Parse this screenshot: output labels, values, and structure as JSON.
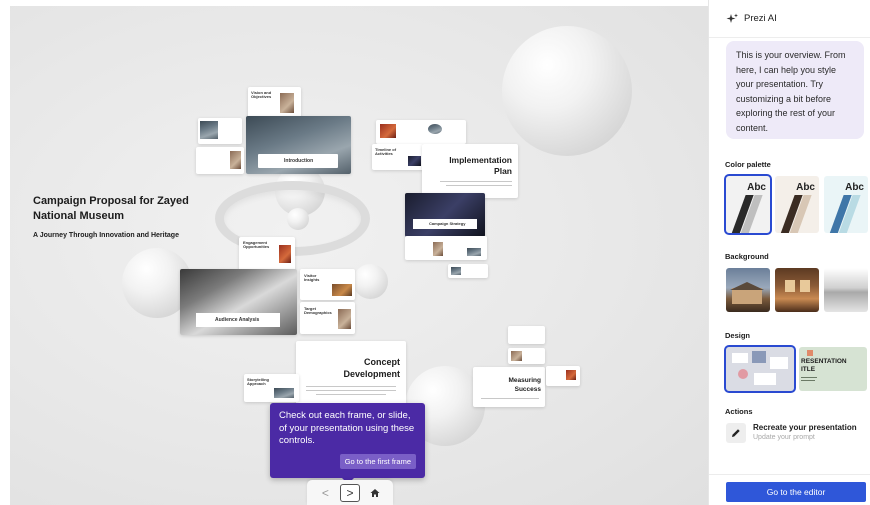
{
  "presentation": {
    "title": "Campaign Proposal for Zayed National Museum",
    "subtitle": "A Journey Through Innovation and Heritage"
  },
  "frames": {
    "vision": "Vision and Objectives",
    "introduction": "Introduction",
    "implementation": "Implementation Plan",
    "campaign_strategy": "Campaign Strategy",
    "engagement": "Engagement Opportunities",
    "visitor": "Visitor Insights",
    "target": "Target Demographics",
    "audience": "Audience Analysis",
    "concept": "Concept Development",
    "storytelling": "Storytelling Approach",
    "measuring": "Measuring Success",
    "timeline": "Timeline of Activities"
  },
  "tooltip": {
    "message": "Check out each frame, or slide, of your presentation using these controls.",
    "button": "Go to the first frame"
  },
  "nav": {
    "prev_glyph": "<",
    "next_glyph": ">",
    "home_icon": "home-icon"
  },
  "panel": {
    "header_title": "Prezi AI",
    "ai_message": "This is your overview. From here, I can help you style your presentation. Try customizing a bit before exploring the rest of your content.",
    "color_palette_label": "Color palette",
    "swatches": [
      {
        "label": "Abc",
        "bg": "#f2f2f2",
        "stripes": [
          "#2a2a2a",
          "#bfbfbf"
        ],
        "selected": true
      },
      {
        "label": "Abc",
        "bg": "#f4efe9",
        "stripes": [
          "#3b2c22",
          "#d8c7b5"
        ],
        "selected": false
      },
      {
        "label": "Abc",
        "bg": "#eaf5f7",
        "stripes": [
          "#3f76a8",
          "#b9dbe4"
        ],
        "selected": false
      }
    ],
    "background_label": "Background",
    "design_label": "Design",
    "design_option_text": "RESENTATION ITLE",
    "actions_label": "Actions",
    "action_title": "Recreate your presentation",
    "action_subtitle": "Update your prompt",
    "editor_button": "Go to the editor"
  },
  "colors": {
    "accent": "#2f57d9",
    "tooltip_bg": "#4b2aa5",
    "bubble_bg": "#eeeaf8"
  }
}
